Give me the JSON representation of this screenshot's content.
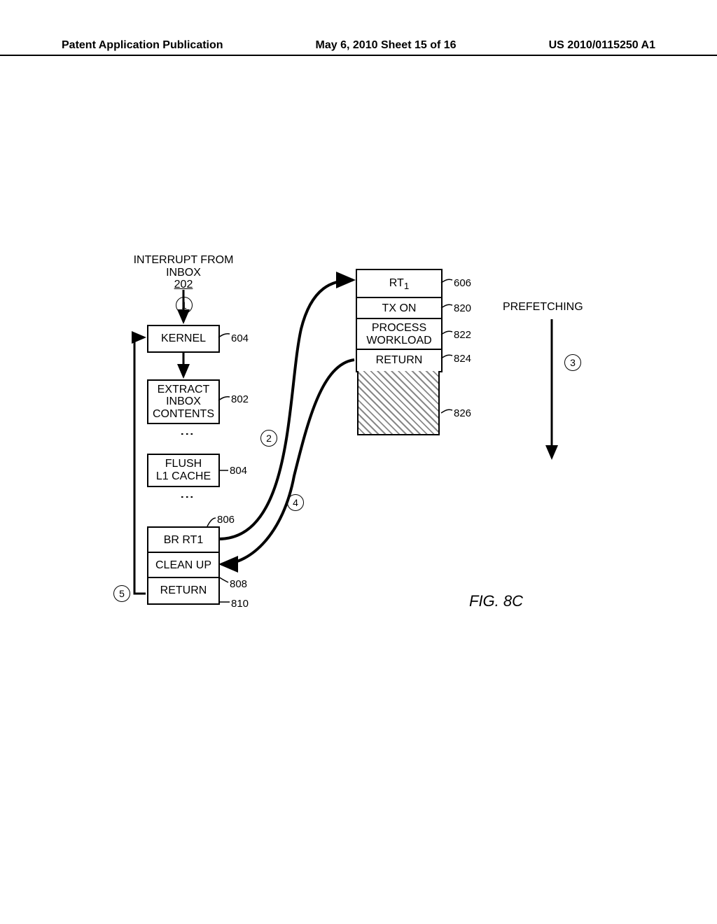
{
  "header": {
    "left": "Patent Application Publication",
    "center": "May 6, 2010  Sheet 15 of 16",
    "right": "US 2010/0115250 A1"
  },
  "labels": {
    "interrupt_line1": "INTERRUPT FROM",
    "interrupt_line2": "INBOX",
    "interrupt_ref": "202",
    "prefetching": "PREFETCHING"
  },
  "left_column": {
    "kernel": "KERNEL",
    "kernel_ref": "604",
    "extract_l1": "EXTRACT",
    "extract_l2": "INBOX",
    "extract_l3": "CONTENTS",
    "extract_ref": "802",
    "flush_l1": "FLUSH",
    "flush_l2": "L1 CACHE",
    "flush_ref": "804",
    "brrt1": "BR RT1",
    "brrt1_ref": "806",
    "cleanup": "CLEAN UP",
    "cleanup_ref": "808",
    "return": "RETURN",
    "return_ref": "810"
  },
  "right_column": {
    "rt1": "RT",
    "rt1_sub": "1",
    "rt1_ref": "606",
    "txon": "TX ON",
    "txon_ref": "820",
    "process_l1": "PROCESS",
    "process_l2": "WORKLOAD",
    "process_ref": "822",
    "return": "RETURN",
    "return_ref": "824",
    "hatch_ref": "826"
  },
  "steps": {
    "s1": "1",
    "s2": "2",
    "s3": "3",
    "s4": "4",
    "s5": "5"
  },
  "figure": "FIG. 8C"
}
